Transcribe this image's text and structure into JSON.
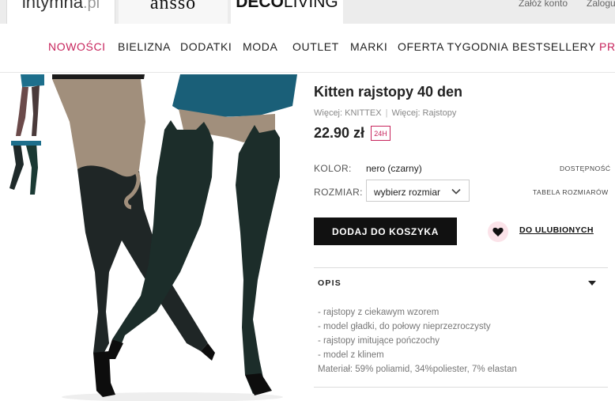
{
  "site_tabs": {
    "intymna_main": "intymna",
    "intymna_tld": ".pl",
    "answear": "ansso",
    "deco_bold": "DECO",
    "deco_rest": "LIVING"
  },
  "top_links": {
    "register": "Załóż konto",
    "login": "Zalogu"
  },
  "nav": {
    "items": [
      "NOWOŚCI",
      "BIELIZNA",
      "DODATKI",
      "MODA",
      "OUTLET",
      "MARKI",
      "OFERTA TYGODNIA",
      "BESTSELLERY",
      "PR"
    ]
  },
  "product": {
    "title": "Kitten rajstopy 40 den",
    "more_brand": "Więcej: KNITTEX",
    "more_category": "Więcej: Rajstopy",
    "price": "22.90 zł",
    "badge": "24H",
    "color_label": "KOLOR:",
    "color_value": "nero (czarny)",
    "availability_link": "DOSTĘPNOŚĆ",
    "size_label": "ROZMIAR:",
    "size_placeholder": "wybierz rozmiar",
    "size_table_link": "TABELA ROZMIARÓW",
    "add_to_cart": "DODAJ DO KOSZYKA",
    "wishlist": "DO ULUBIONYCH"
  },
  "description": {
    "heading": "OPIS",
    "lines": [
      "- rajstopy z ciekawym wzorem",
      "- model gładki, do połowy nieprzezroczysty",
      "- rajstopy imitujące pończochy",
      "- model z klinem",
      "Materiał: 59% poliamid, 34%poliester, 7% elastan"
    ]
  },
  "colors": {
    "accent": "#c7245c",
    "button_bg": "#111111",
    "wishlist_bg": "#fbe3e9"
  },
  "icons": {
    "size_select": "chevron-down-icon",
    "wishlist": "heart-icon",
    "opis_toggle": "caret-down-icon"
  }
}
